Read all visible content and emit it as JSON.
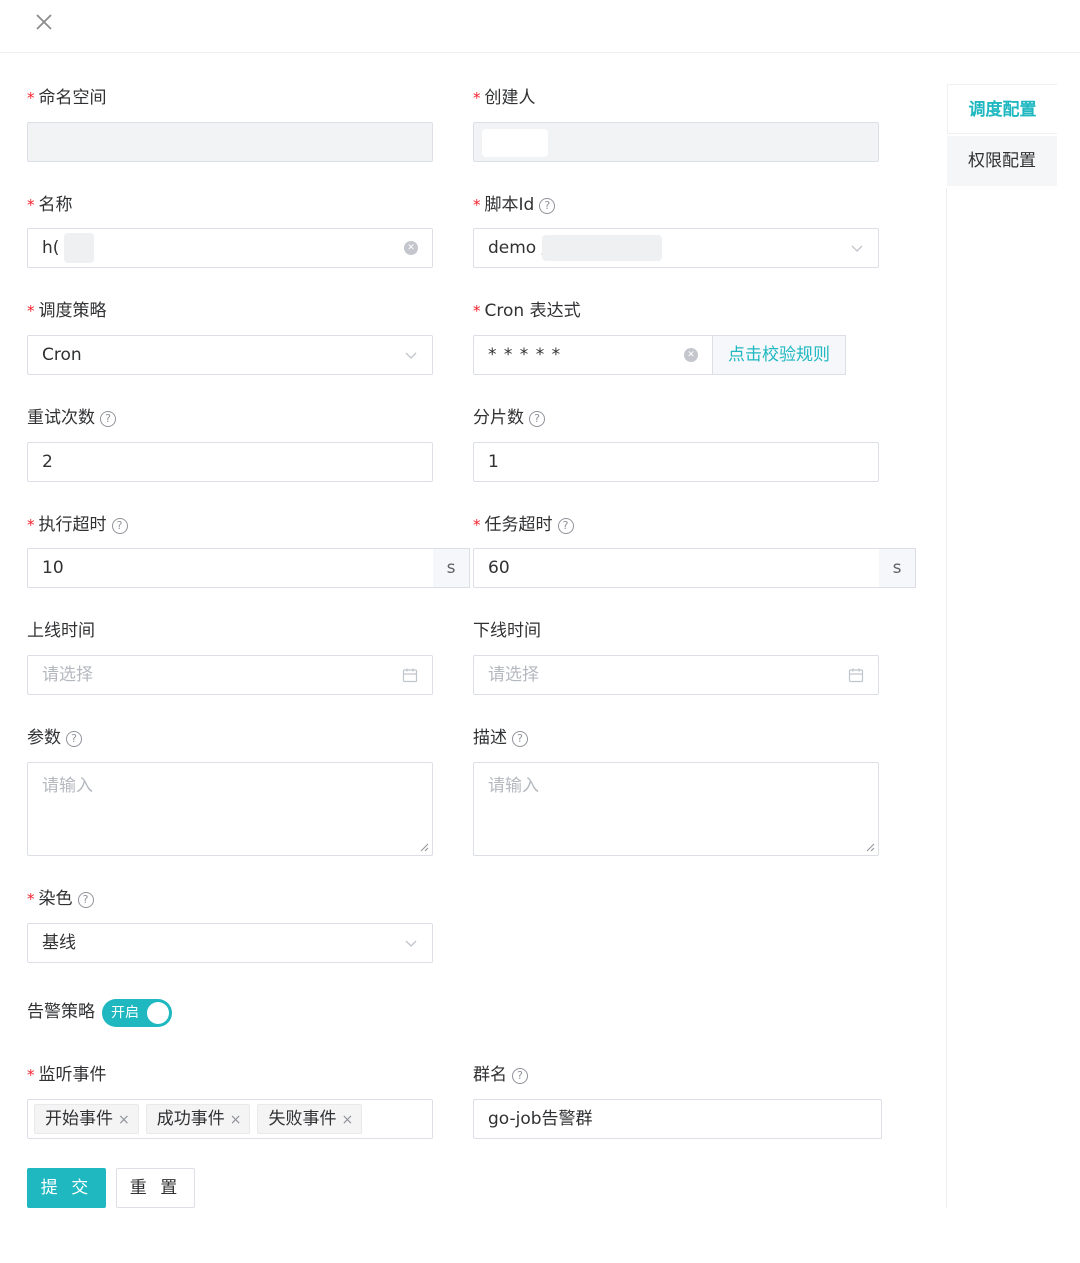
{
  "colors": {
    "accent": "#1fb8c1",
    "required": "#f5222d",
    "border": "#dcdfe6",
    "disabled_bg": "#f2f3f5"
  },
  "header": {
    "close_icon": "close-icon"
  },
  "side_tabs": [
    {
      "label": "调度配置",
      "active": true
    },
    {
      "label": "权限配置",
      "active": false
    }
  ],
  "form": {
    "namespace": {
      "label": "命名空间",
      "value": ""
    },
    "creator": {
      "label": "创建人",
      "value": ""
    },
    "name": {
      "label": "名称",
      "value": "h("
    },
    "script_id": {
      "label": "脚本Id",
      "value": "demo /"
    },
    "schedule_strategy": {
      "label": "调度策略",
      "value": "Cron"
    },
    "cron": {
      "label": "Cron 表达式",
      "value": "* * * * *",
      "validate_button": "点击校验规则"
    },
    "retry_count": {
      "label": "重试次数",
      "value": "2"
    },
    "shard_count": {
      "label": "分片数",
      "value": "1"
    },
    "exec_timeout": {
      "label": "执行超时",
      "value": "10",
      "unit": "s"
    },
    "task_timeout": {
      "label": "任务超时",
      "value": "60",
      "unit": "s"
    },
    "online_time": {
      "label": "上线时间",
      "placeholder": "请选择"
    },
    "offline_time": {
      "label": "下线时间",
      "placeholder": "请选择"
    },
    "params": {
      "label": "参数",
      "placeholder": "请输入"
    },
    "description": {
      "label": "描述",
      "placeholder": "请输入"
    },
    "dye": {
      "label": "染色",
      "value": "基线"
    },
    "alert_strategy": {
      "label": "告警策略",
      "switch_text": "开启",
      "enabled": true
    },
    "listen_events": {
      "label": "监听事件",
      "tags": [
        "开始事件",
        "成功事件",
        "失败事件"
      ]
    },
    "group_name": {
      "label": "群名",
      "value": "go-job告警群"
    }
  },
  "actions": {
    "submit_label": "提 交",
    "reset_label": "重 置"
  }
}
